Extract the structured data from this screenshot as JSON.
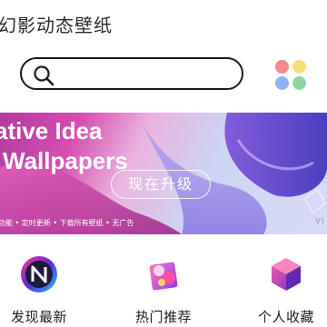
{
  "app": {
    "title": "幻影动态壁纸"
  },
  "search": {
    "placeholder": ""
  },
  "menu_dots": {
    "colors": [
      "#f48c8c",
      "#f7df75",
      "#8eb3f2",
      "#8dd6a4"
    ]
  },
  "banner": {
    "line1": "ative Idea",
    "line2": "Wallpapers",
    "upgrade_label": "现在升级",
    "features": "功能 • 定时更新 • 下载所有壁纸 • 无广告",
    "corner_text": "VI"
  },
  "categories": [
    {
      "label": "发现最新",
      "icon": "discover-icon"
    },
    {
      "label": "热门推荐",
      "icon": "hot-recommend-icon"
    },
    {
      "label": "个人收藏",
      "icon": "favorites-icon"
    }
  ]
}
